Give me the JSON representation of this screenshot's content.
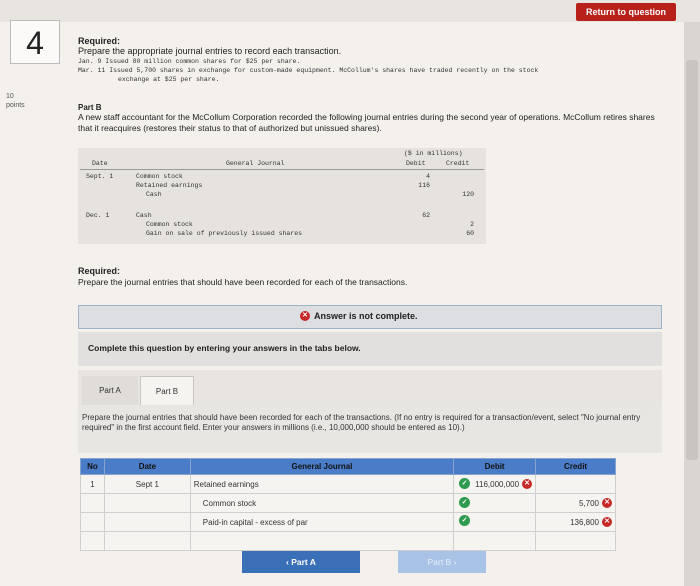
{
  "header": {
    "return_label": "Return to question"
  },
  "question": {
    "number": "4",
    "points": "10\npoints",
    "required_label": "Required:",
    "prepare_text": "Prepare the appropriate journal entries to record each transaction.",
    "transactions": [
      "Jan.  9 Issued 80 million common shares for $25 per share.",
      "Mar. 11 Issued 5,700 shares in exchange for custom-made equipment. McCollum's shares have traded recently on the stock",
      "exchange at $25 per share."
    ]
  },
  "part_b": {
    "title": "Part B",
    "text": "A new staff accountant for the McCollum Corporation recorded the following journal entries during the second year of operations. McCollum retires shares that it reacquires (restores their status to that of authorized but unissued shares).",
    "journal": {
      "units": "($ in millions)",
      "col_date": "Date",
      "col_general": "General Journal",
      "col_debit": "Debit",
      "col_credit": "Credit",
      "rows": [
        {
          "date": "Sept. 1",
          "account": "Common stock",
          "debit": "4",
          "credit": ""
        },
        {
          "date": "",
          "account": "Retained earnings",
          "debit": "116",
          "credit": ""
        },
        {
          "date": "",
          "account": "Cash",
          "debit": "",
          "credit": "120"
        },
        {
          "date": "Dec. 1",
          "account": "Cash",
          "debit": "62",
          "credit": ""
        },
        {
          "date": "",
          "account": "Common stock",
          "debit": "",
          "credit": "2"
        },
        {
          "date": "",
          "account": "Gain on sale of previously issued shares",
          "debit": "",
          "credit": "60"
        }
      ]
    },
    "required_label": "Required:",
    "required_text": "Prepare the journal entries that should have been recorded for each of the transactions."
  },
  "status": {
    "answer_msg": "Answer is not complete."
  },
  "instructions": {
    "complete_text": "Complete this question by entering your answers in the tabs below.",
    "tab_a": "Part A",
    "tab_b": "Part B",
    "tab_text": "Prepare the journal entries that should have been recorded for each of the transactions. (If no entry is required for a transaction/event, select \"No journal entry required\" in the first account field. Enter your answers in millions (i.e., 10,000,000 should be entered as 10).)"
  },
  "answer_table": {
    "headers": {
      "no": "No",
      "date": "Date",
      "general": "General Journal",
      "debit": "Debit",
      "credit": "Credit"
    },
    "rows": [
      {
        "no": "1",
        "date": "Sept 1",
        "account": "Retained earnings",
        "debit": "116,000,000",
        "credit": ""
      },
      {
        "no": "",
        "date": "",
        "account": "Common stock",
        "debit": "",
        "credit": "5,700"
      },
      {
        "no": "",
        "date": "",
        "account": "Paid-in capital - excess of par",
        "debit": "",
        "credit": "136,800"
      },
      {
        "no": "",
        "date": "",
        "account": "",
        "debit": "",
        "credit": ""
      }
    ]
  },
  "nav": {
    "prev_label": "‹  Part A",
    "next_label": "Part B  ›"
  },
  "colors": {
    "accent": "#3a70b8",
    "error": "#c62828",
    "success": "#2e9b4f",
    "return": "#b8211a"
  }
}
